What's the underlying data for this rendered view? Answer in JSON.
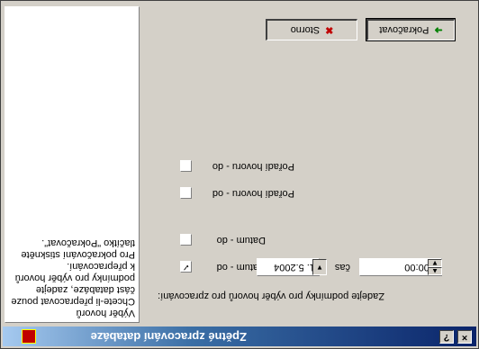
{
  "window": {
    "title": "Zpětné zpracování databáze",
    "help_label": "?",
    "close_label": "×"
  },
  "info": {
    "text": "Výběr hovorů\nChcete-li přepracovat pouze\nčást databáze, zadejte\npodmínky pro výběr hovorů\nk přepracování.\nPro pokračování stiskněte\ntlačítko \"Pokračovat\"."
  },
  "form": {
    "prompt": "Zadejte podmínky pro výběr hovorů pro zpracování:",
    "datum_od": {
      "label": "Datum - od",
      "checked": true,
      "date_value": "1. 5.2004",
      "time_label": "čas",
      "time_value": "0:00:00"
    },
    "datum_do": {
      "label": "Datum - do",
      "checked": false
    },
    "poradi_od": {
      "label": "Pořadí hovoru - od",
      "checked": false
    },
    "poradi_do": {
      "label": "Pořadí hovoru - do",
      "checked": false
    }
  },
  "buttons": {
    "continue_label": "Pokračovat",
    "cancel_label": "Storno"
  },
  "colors": {
    "titlebar_start": "#0a246a",
    "titlebar_end": "#a6caf0",
    "cancel_icon": "#c00000",
    "continue_icon": "#008000"
  },
  "icons": {
    "app": "database-icon",
    "continue": "green-arrow-icon",
    "cancel": "red-x-icon"
  }
}
